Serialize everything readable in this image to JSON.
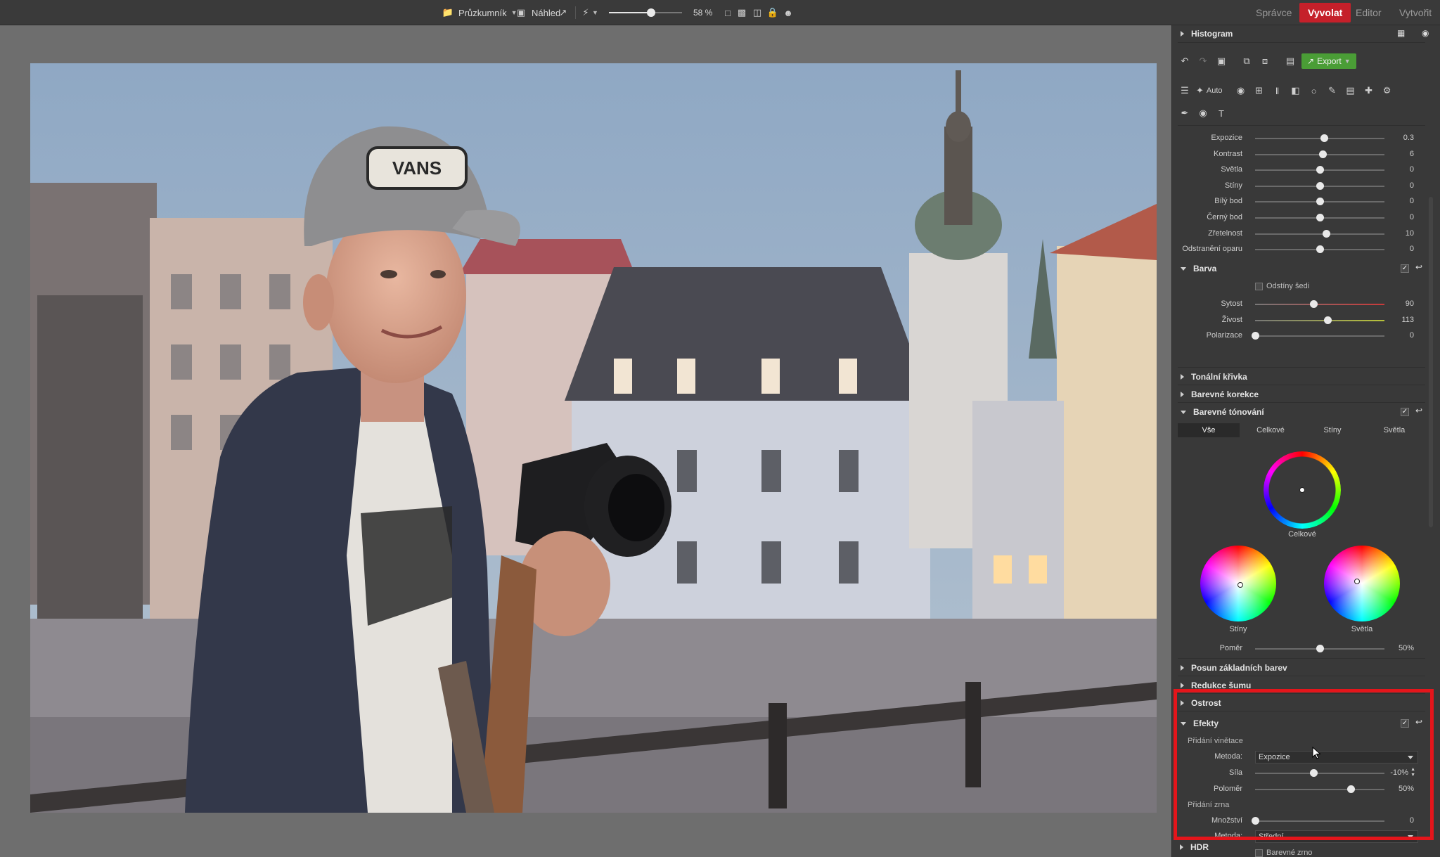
{
  "topbar": {
    "explorer_label": "Průzkumník",
    "preview_label": "Náhled",
    "zoom_percent": "58 %",
    "zoom_level": 0.58,
    "modes": [
      "Správce",
      "Vyvolat",
      "Editor",
      "Vytvořit"
    ],
    "active_mode": "Vyvolat",
    "accent": "#c5202a"
  },
  "panel": {
    "histogram_title": "Histogram",
    "export_label": "Export",
    "auto_label": "Auto",
    "basic_sliders": [
      {
        "label": "Expozice",
        "value": "0.3",
        "pos": 0.53
      },
      {
        "label": "Kontrast",
        "value": "6",
        "pos": 0.52
      },
      {
        "label": "Světla",
        "value": "0",
        "pos": 0.5
      },
      {
        "label": "Stíny",
        "value": "0",
        "pos": 0.5
      },
      {
        "label": "Bílý bod",
        "value": "0",
        "pos": 0.5
      },
      {
        "label": "Černý bod",
        "value": "0",
        "pos": 0.5
      },
      {
        "label": "Zřetelnost",
        "value": "10",
        "pos": 0.55
      },
      {
        "label": "Odstranění oparu",
        "value": "0",
        "pos": 0.5
      }
    ],
    "color": {
      "title": "Barva",
      "grayscale_label": "Odstíny šedi",
      "sliders": [
        {
          "label": "Sytost",
          "value": "90",
          "pos": 0.45
        },
        {
          "label": "Živost",
          "value": "113",
          "pos": 0.56
        },
        {
          "label": "Polarizace",
          "value": "0",
          "pos": 0.0
        }
      ]
    },
    "tone_curve_title": "Tonální křivka",
    "color_corrections_title": "Barevné korekce",
    "toning": {
      "title": "Barevné tónování",
      "tabs": [
        "Vše",
        "Celkové",
        "Stíny",
        "Světla"
      ],
      "active_tab": "Vše",
      "wheel_overall": "Celkové",
      "wheel_shadows": "Stíny",
      "wheel_highlights": "Světla",
      "ratio_label": "Poměr",
      "ratio_value": "50%",
      "ratio_pos": 0.5
    },
    "shift_title": "Posun základních barev",
    "noise_title": "Redukce šumu",
    "sharpness_title": "Ostrost",
    "effects": {
      "title": "Efekty",
      "vignette_label": "Přidání vinětace",
      "method_label": "Metoda:",
      "vignette_method": "Expozice",
      "strength_label": "Síla",
      "strength_value": "-10%",
      "strength_pos": 0.45,
      "radius_label": "Poloměr",
      "radius_value": "50%",
      "radius_pos": 0.74,
      "grain_label": "Přidání zrna",
      "amount_label": "Množství",
      "amount_value": "0",
      "amount_pos": 0.0,
      "grain_method_label": "Metoda:",
      "grain_method": "Střední",
      "color_grain_label": "Barevné zrno"
    },
    "hdr_title": "HDR",
    "highlight_color": "#e4151b"
  }
}
